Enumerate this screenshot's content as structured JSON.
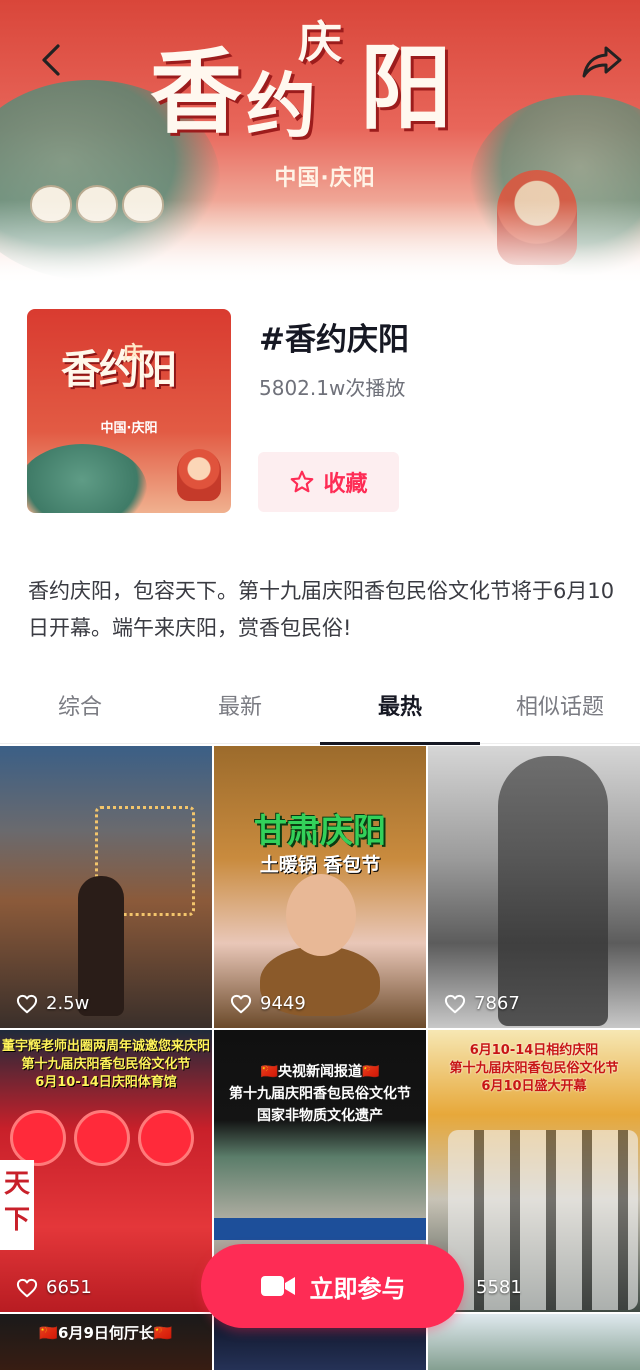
{
  "header": {
    "banner_title": [
      "香",
      "约",
      "阳"
    ],
    "banner_title_small": "庆",
    "banner_subtitle": "中国·庆阳"
  },
  "topic": {
    "cover_title": "香约阳",
    "cover_title_small": "庆",
    "cover_subtitle": "中国·庆阳",
    "title": "#香约庆阳",
    "play_count": "5802.1w次播放",
    "favorite_label": "收藏",
    "description": "香约庆阳，包容天下。第十九届庆阳香包民俗文化节将于6月10日开幕。端午来庆阳，赏香包民俗!"
  },
  "tabs": [
    {
      "label": "综合",
      "active": false
    },
    {
      "label": "最新",
      "active": false
    },
    {
      "label": "最热",
      "active": true
    },
    {
      "label": "相似话题",
      "active": false
    }
  ],
  "videos": [
    {
      "likes": "2.5w"
    },
    {
      "likes": "9449",
      "overlay_title": "甘肃庆阳",
      "overlay_sub": "土暖锅 香包节"
    },
    {
      "likes": "7867"
    },
    {
      "likes": "6651",
      "captions": [
        "董宇辉老师出圈两周年诚邀您来庆阳",
        "第十九届庆阳香包民俗文化节",
        "6月10-14日庆阳体育馆"
      ],
      "stamp": "天下"
    },
    {
      "likes": "",
      "captions": [
        "🇨🇳央视新闻报道🇨🇳",
        "第十九届庆阳香包民俗文化节",
        "国家非物质文化遗产"
      ]
    },
    {
      "likes": "5581",
      "captions": [
        "6月10-14日相约庆阳",
        "第十九届庆阳香包民俗文化节",
        "6月10日盛大开幕"
      ]
    },
    {
      "captions": [
        "🇨🇳6月9日何厅长🇨🇳"
      ]
    },
    {},
    {}
  ],
  "join_button": {
    "label": "立即参与"
  },
  "colors": {
    "accent": "#fe2c55",
    "accent_bg": "#fdeef0",
    "text_primary": "#161823",
    "text_secondary": "#6f717a"
  },
  "icons": {
    "back": "chevron-left-icon",
    "share": "share-arrow-icon",
    "favorite": "star-outline-icon",
    "like": "heart-outline-icon",
    "join": "video-camera-icon"
  }
}
